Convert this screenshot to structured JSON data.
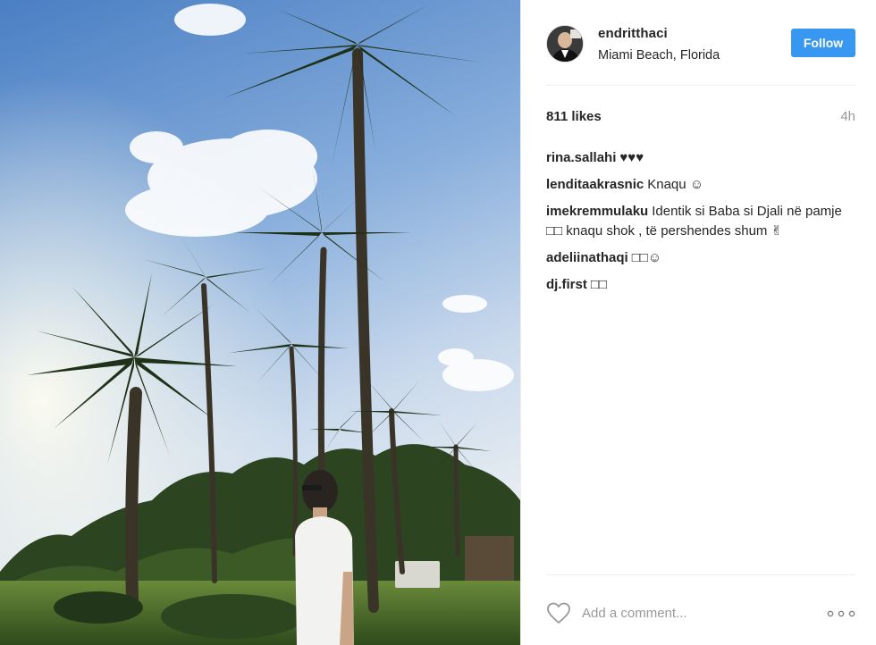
{
  "post": {
    "username": "endritthaci",
    "location": "Miami Beach, Florida",
    "follow_label": "Follow",
    "likes": "811 likes",
    "time_ago": "4h"
  },
  "comments": [
    {
      "user": "rina.sallahi",
      "text": "♥♥♥"
    },
    {
      "user": "lenditaakrasnic",
      "text": "Knaqu ☺"
    },
    {
      "user": "imekremmulaku",
      "text": "Identik si Baba si Djali në pamje □□ knaqu shok , të pershendes shum ✌"
    },
    {
      "user": "adeliinathaqi",
      "text": "□□☺"
    },
    {
      "user": "dj.first",
      "text": "□□"
    }
  ],
  "add_comment": {
    "placeholder": "Add a comment..."
  },
  "icons": {
    "like": "heart-icon",
    "more": "more-options-icon"
  },
  "colors": {
    "accent": "#3897f0",
    "text": "#262626",
    "muted": "#999999",
    "divider": "#efefef"
  }
}
